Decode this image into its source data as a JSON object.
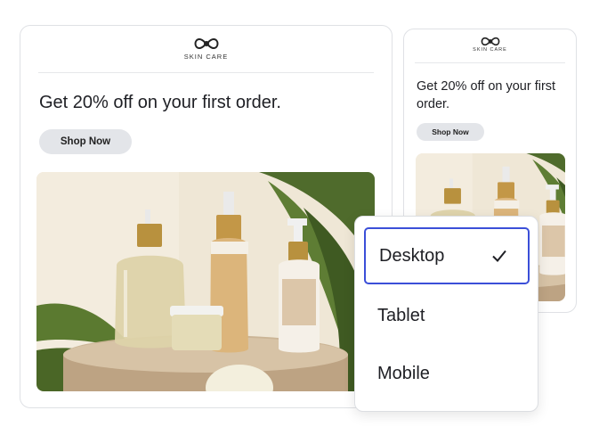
{
  "preview": {
    "brand_name": "SKIN CARE",
    "headline": "Get 20% off on your first order.",
    "cta_label": "Shop Now"
  },
  "device_menu": {
    "selected": "Desktop",
    "options": [
      {
        "label": "Desktop",
        "icon": "check-icon"
      },
      {
        "label": "Tablet"
      },
      {
        "label": "Mobile"
      }
    ]
  },
  "colors": {
    "selection_border": "#3b4fd8",
    "button_bg": "#e3e5e9",
    "card_border": "#dfe1e5"
  },
  "icons": [
    "infinity-logo-icon",
    "check-icon"
  ]
}
